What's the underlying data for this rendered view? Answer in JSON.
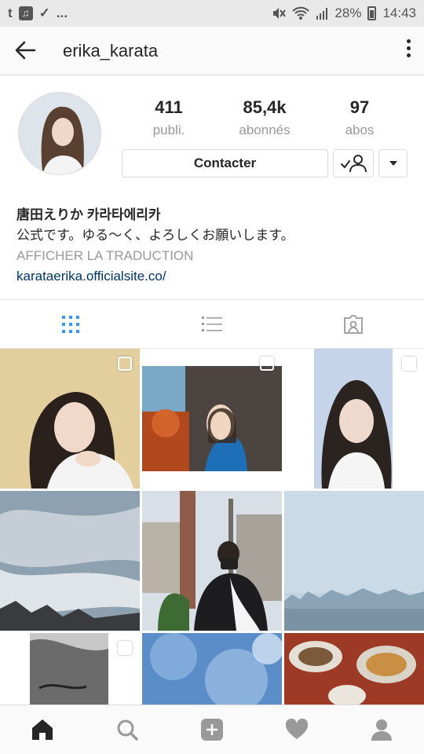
{
  "status_bar": {
    "left_icons": [
      "t",
      "♫",
      "✓",
      "..."
    ],
    "battery": "28%",
    "time": "14:43"
  },
  "header": {
    "username": "erika_karata"
  },
  "profile": {
    "stats": [
      {
        "value": "411",
        "label": "publi."
      },
      {
        "value": "85,4k",
        "label": "abonnés"
      },
      {
        "value": "97",
        "label": "abos"
      }
    ],
    "contact_label": "Contacter"
  },
  "bio": {
    "name": "唐田えりか 카라타에리카",
    "text": "公式です。ゆる〜く、よろしくお願いします。",
    "translate": "AFFICHER LA TRADUCTION",
    "link": "karataerika.officialsite.co/"
  },
  "tabs": [
    {
      "icon": "grid-icon",
      "active": true
    },
    {
      "icon": "list-icon",
      "active": false
    },
    {
      "icon": "tagged-icon",
      "active": false
    }
  ],
  "colors": {
    "active_tab": "#3897f0",
    "inactive_icon": "#999999",
    "link": "#003569"
  },
  "bottom_nav": [
    "home-icon",
    "search-icon",
    "add-icon",
    "heart-icon",
    "profile-icon"
  ]
}
